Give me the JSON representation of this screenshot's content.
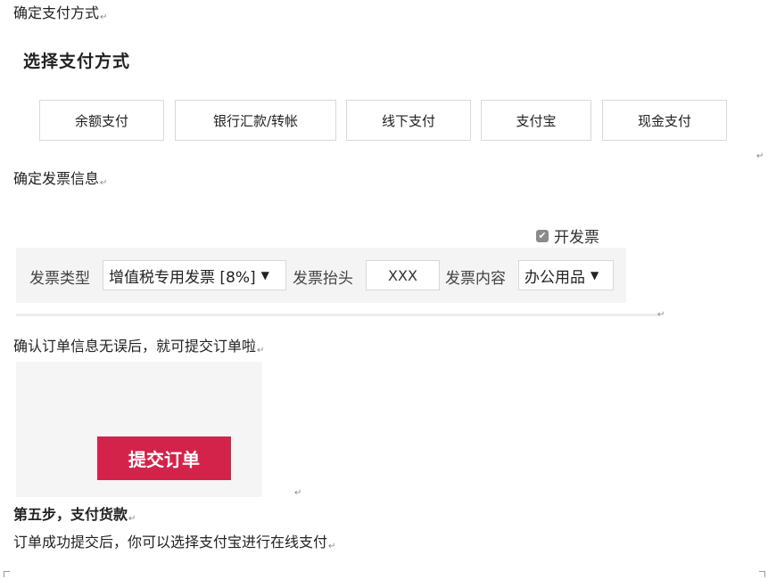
{
  "payment": {
    "section_title": "确定支付方式",
    "heading": "选择支付方式",
    "methods": [
      "余额支付",
      "银行汇款/转帐",
      "线下支付",
      "支付宝",
      "现金支付"
    ]
  },
  "invoice": {
    "section_title": "确定发票信息",
    "checkbox_label": "开发票",
    "checkbox_checked": true,
    "type_label": "发票类型",
    "type_value": "增值税专用发票 [8%]",
    "header_label": "发票抬头",
    "header_value": "XXX",
    "content_label": "发票内容",
    "content_value": "办公用品"
  },
  "order": {
    "confirm_text": "确认订单信息无误后，就可提交订单啦",
    "submit_label": "提交订单"
  },
  "step5": {
    "title": "第五步，支付货款",
    "text": "订单成功提交后，你可以选择支付宝进行在线支付"
  },
  "marks": {
    "paragraph": "↵"
  }
}
